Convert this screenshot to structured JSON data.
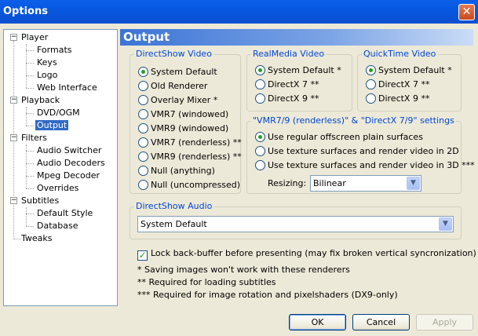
{
  "window": {
    "title": "Options",
    "close_glyph": "✕"
  },
  "tree": {
    "items": [
      {
        "label": "Player",
        "level": 0,
        "expanded": true
      },
      {
        "label": "Formats",
        "level": 1
      },
      {
        "label": "Keys",
        "level": 1
      },
      {
        "label": "Logo",
        "level": 1
      },
      {
        "label": "Web Interface",
        "level": 1
      },
      {
        "label": "Playback",
        "level": 0,
        "expanded": true
      },
      {
        "label": "DVD/OGM",
        "level": 1
      },
      {
        "label": "Output",
        "level": 1,
        "selected": true
      },
      {
        "label": "Filters",
        "level": 0,
        "expanded": true
      },
      {
        "label": "Audio Switcher",
        "level": 1
      },
      {
        "label": "Audio Decoders",
        "level": 1
      },
      {
        "label": "Mpeg Decoder",
        "level": 1
      },
      {
        "label": "Overrides",
        "level": 1
      },
      {
        "label": "Subtitles",
        "level": 0,
        "expanded": true
      },
      {
        "label": "Default Style",
        "level": 1
      },
      {
        "label": "Database",
        "level": 1
      },
      {
        "label": "Tweaks",
        "level": 0
      }
    ],
    "expander_glyph": "−"
  },
  "panel": {
    "title": "Output"
  },
  "directshow_video": {
    "legend": "DirectShow Video",
    "options": [
      {
        "label": "System Default",
        "checked": true
      },
      {
        "label": "Old Renderer",
        "checked": false
      },
      {
        "label": "Overlay Mixer *",
        "checked": false
      },
      {
        "label": "VMR7 (windowed)",
        "checked": false
      },
      {
        "label": "VMR9 (windowed)",
        "checked": false
      },
      {
        "label": "VMR7 (renderless) **",
        "checked": false
      },
      {
        "label": "VMR9 (renderless) **",
        "checked": false
      },
      {
        "label": "Null (anything)",
        "checked": false
      },
      {
        "label": "Null (uncompressed)",
        "checked": false
      }
    ]
  },
  "realmedia_video": {
    "legend": "RealMedia Video",
    "options": [
      {
        "label": "System Default *",
        "checked": true
      },
      {
        "label": "DirectX 7 **",
        "checked": false
      },
      {
        "label": "DirectX 9 **",
        "checked": false
      }
    ]
  },
  "quicktime_video": {
    "legend": "QuickTime Video",
    "options": [
      {
        "label": "System Default *",
        "checked": true
      },
      {
        "label": "DirectX 7 **",
        "checked": false
      },
      {
        "label": "DirectX 9 **",
        "checked": false
      }
    ]
  },
  "vmr_settings": {
    "legend": "\"VMR7/9 (renderless)\" & \"DirectX 7/9\" settings",
    "options": [
      {
        "label": "Use regular offscreen plain surfaces",
        "checked": true
      },
      {
        "label": "Use texture surfaces and render video in 2D",
        "checked": false
      },
      {
        "label": "Use texture surfaces and render video in 3D ***",
        "checked": false
      }
    ],
    "resizing_label": "Resizing:",
    "resizing_value": "Bilinear"
  },
  "directshow_audio": {
    "legend": "DirectShow Audio",
    "value": "System Default"
  },
  "lock_backbuffer": {
    "label": "Lock back-buffer before presenting (may fix broken vertical syncronization)",
    "checked": true,
    "check_glyph": "✓"
  },
  "notes": [
    "* Saving images won't work with these renderers",
    "** Required for loading subtitles",
    "*** Required for image rotation and pixelshaders (DX9-only)"
  ],
  "buttons": {
    "ok": "OK",
    "cancel": "Cancel",
    "apply": "Apply"
  },
  "dropdown_glyph": "▼"
}
